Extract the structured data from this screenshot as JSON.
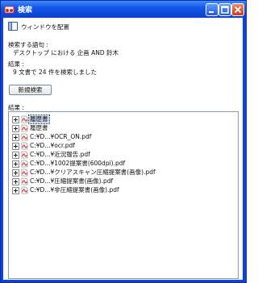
{
  "window": {
    "title": "検索"
  },
  "options": {
    "arrange_label": "ウィンドウを配置"
  },
  "search": {
    "query_label": "検索する語句 :",
    "query_value": "デスクトップ における 企画 AND 鈴木",
    "result_label": "結果 :",
    "result_summary": "9 文書で 24 件を検索しました"
  },
  "buttons": {
    "new_search": "新規検索"
  },
  "results": {
    "label": "結果 :",
    "items": [
      {
        "label": "履歴書",
        "selected": true
      },
      {
        "label": "履歴書"
      },
      {
        "label": "C:¥D...¥OCR_ON.pdf"
      },
      {
        "label": "C:¥D...¥ocr.pdf"
      },
      {
        "label": "C:¥D...¥近況報告.pdf"
      },
      {
        "label": "C:¥D...¥1002提案書(600dpi).pdf"
      },
      {
        "label": "C:¥D...¥クリアスキャン圧縮提案書(画像).pdf"
      },
      {
        "label": "C:¥D...¥圧縮提案書(画像).pdf"
      },
      {
        "label": "C:¥D...¥非圧縮提案書(画像).pdf"
      }
    ]
  },
  "colors": {
    "titlebar": "#0b47dc",
    "close": "#d9461f",
    "selection": "#c9d6ef",
    "pdf_icon": "#d32f1f"
  }
}
